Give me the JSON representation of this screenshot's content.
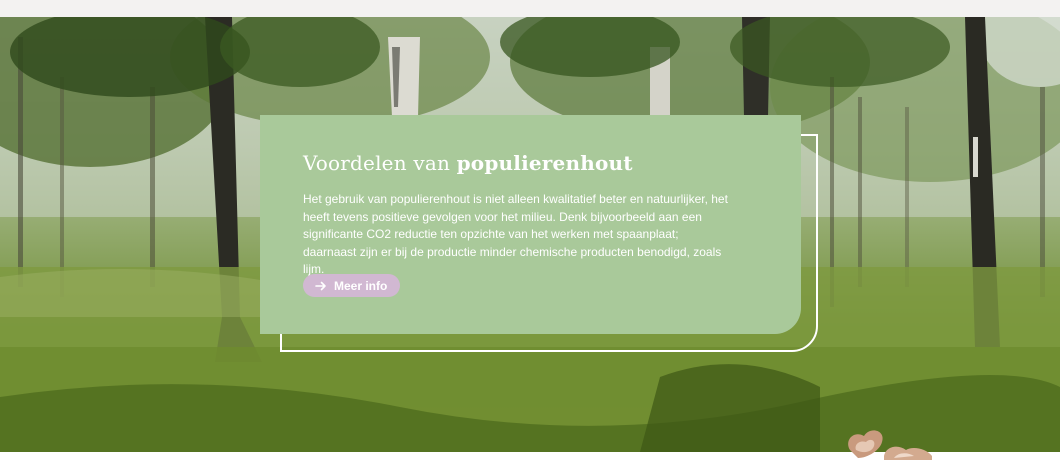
{
  "hero": {
    "title_light": "Voordelen van ",
    "title_bold": "populierenhout",
    "body": "Het gebruik van populierenhout is niet alleen kwalitatief beter en natuurlijker, het heeft tevens positieve gevolgen voor het milieu. Denk bijvoorbeeld aan een significante CO2 reductie ten opzichte van het werken met spaanplaat; daarnaast zijn er bij de productie minder chemische producten benodigd, zoals lijm.",
    "button_label": "Meer info",
    "button_icon": "arrow-right-icon"
  },
  "colors": {
    "card_background": "#a9c99a",
    "button_background": "#d1b8d2",
    "text": "#ffffff"
  }
}
